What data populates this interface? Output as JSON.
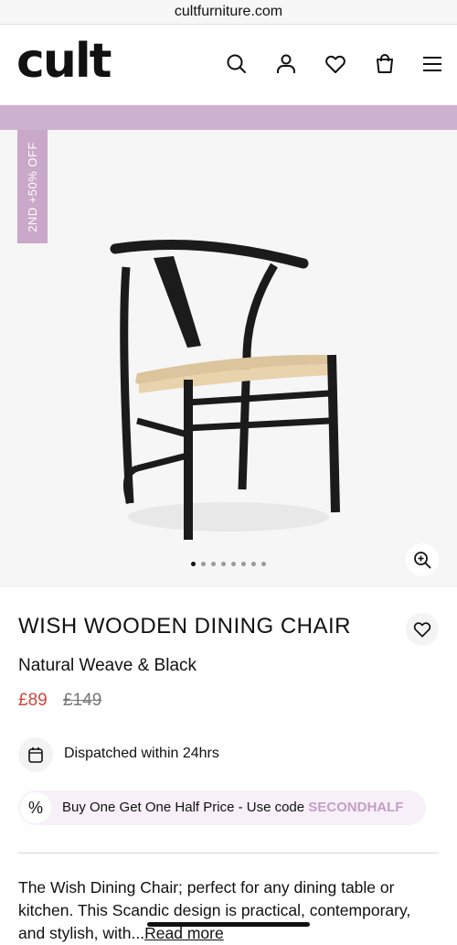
{
  "browser": {
    "url": "cultfurniture.com"
  },
  "header": {
    "logo_text": "cult",
    "icons": [
      "search-icon",
      "account-icon",
      "wishlist-icon",
      "bag-icon",
      "menu-icon"
    ]
  },
  "colors": {
    "promo_strip": "#cdb2cf",
    "badge": "#c9a8c9",
    "sale_price": "#d2463d",
    "promo_code": "#c49fc6"
  },
  "product": {
    "badge": "2ND +50% OFF",
    "title": "WISH WOODEN DINING CHAIR",
    "variant": "Natural Weave & Black",
    "price": "£89",
    "was_price": "£149",
    "gallery": {
      "image_count": 8,
      "active_index": 0
    },
    "dispatch": "Dispatched within 24hrs",
    "offer": {
      "text": "Buy One Get One Half Price - Use code ",
      "code": "SECONDHALF"
    },
    "description": "The Wish Dining Chair; perfect for any dining table or kitchen. This Scandic design is practical, contemporary, and stylish, with...",
    "read_more": "Read more"
  }
}
